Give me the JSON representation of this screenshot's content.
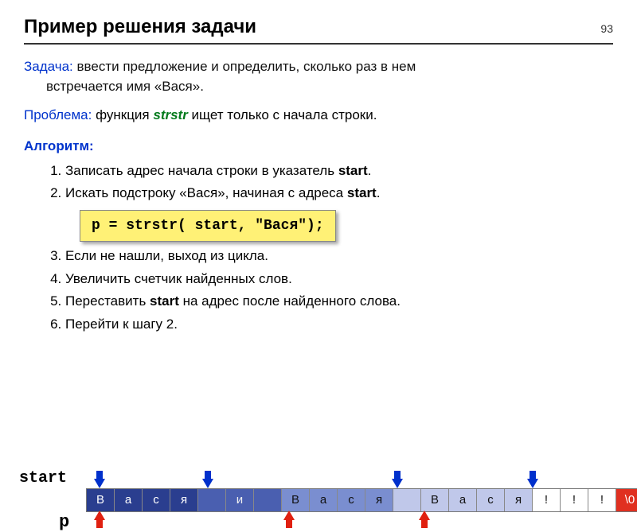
{
  "page_number": "93",
  "title": "Пример решения задачи",
  "task": {
    "label": "Задача:",
    "text": " ввести предложение и определить, сколько раз в нем",
    "text2": "встречается имя «Вася»."
  },
  "problem": {
    "label": "Проблема:",
    "prefix": " функция ",
    "func": "strstr",
    "suffix": " ищет только с начала строки."
  },
  "algo": {
    "label": "Алгоритм:",
    "items": [
      {
        "pre": "Записать адрес начала строки в указатель ",
        "b": "start",
        "post": "."
      },
      {
        "pre": "Искать подстроку «Вася», начиная с адреса ",
        "b": "start",
        "post": "."
      },
      {
        "pre": "Если не нашли, выход из цикла.",
        "b": "",
        "post": ""
      },
      {
        "pre": "Увеличить счетчик найденных слов.",
        "b": "",
        "post": ""
      },
      {
        "pre": "Переставить ",
        "b": "start",
        "post": " на адрес после найденного слова."
      },
      {
        "pre": "Перейти к шагу 2.",
        "b": "",
        "post": ""
      }
    ]
  },
  "code_box": "p = strstr( start, \"Вася\");",
  "diagram": {
    "start_label": "start",
    "p_label": "p",
    "cells": [
      {
        "t": "В",
        "c": "bg1"
      },
      {
        "t": "а",
        "c": "bg1"
      },
      {
        "t": "с",
        "c": "bg1"
      },
      {
        "t": "я",
        "c": "bg1"
      },
      {
        "t": " ",
        "c": "bg2"
      },
      {
        "t": "и",
        "c": "bg2"
      },
      {
        "t": " ",
        "c": "bg2"
      },
      {
        "t": "В",
        "c": "bg3"
      },
      {
        "t": "а",
        "c": "bg3"
      },
      {
        "t": "с",
        "c": "bg3"
      },
      {
        "t": "я",
        "c": "bg3"
      },
      {
        "t": " ",
        "c": "bg4"
      },
      {
        "t": "В",
        "c": "bg4"
      },
      {
        "t": "а",
        "c": "bg4"
      },
      {
        "t": "с",
        "c": "bg4"
      },
      {
        "t": "я",
        "c": "bg4"
      },
      {
        "t": "!",
        "c": "bg5"
      },
      {
        "t": "!",
        "c": "bg5"
      },
      {
        "t": "!",
        "c": "bg5"
      },
      {
        "t": "\\0",
        "c": "bg6"
      }
    ],
    "blue_arrow_cols": [
      0,
      4,
      11,
      16
    ],
    "red_arrow_cols": [
      0,
      7,
      12
    ]
  }
}
